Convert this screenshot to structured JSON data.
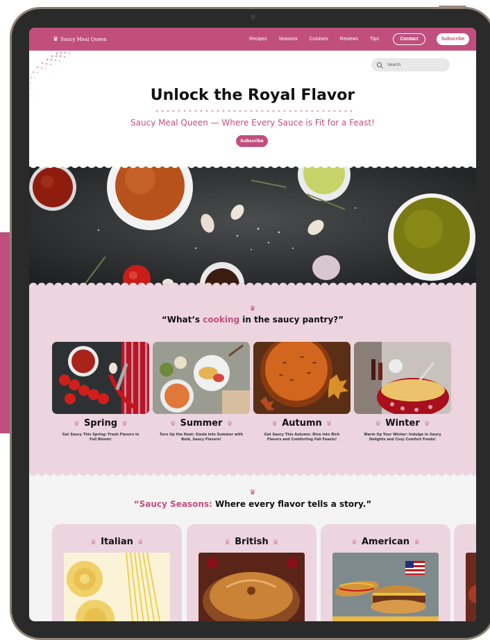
{
  "brand": {
    "name": "Saucy Meal Queen",
    "color": "#c14f7e"
  },
  "nav": {
    "links": [
      "Recipes",
      "Seasons",
      "Cuisines",
      "Reviews",
      "Tips"
    ],
    "contact_label": "Contact",
    "subscribe_label": "Subscribe"
  },
  "search": {
    "placeholder": "Search"
  },
  "hero": {
    "title": "Unlock the Royal Flavor",
    "subtitle": "Saucy Meal Queen — Where Every Sauce is Fit for a Feast!",
    "button_label": "Subscribe"
  },
  "seasons_section": {
    "title_open": "“What’s ",
    "title_accent": "cooking",
    "title_rest": " in the saucy pantry?”",
    "cards": [
      {
        "title": "Spring",
        "desc": "Get Saucy This Spring: Fresh Flavors in Full Bloom!"
      },
      {
        "title": "Summer",
        "desc": "Turn Up the Heat: Sizzle into Summer with Bold, Saucy Flavors!"
      },
      {
        "title": "Autumn",
        "desc": "Get Saucy This Autumn: Dive into Rich Flavors and Comforting Fall Feasts!"
      },
      {
        "title": "Winter",
        "desc": "Warm Up Your Winter: Indulge in Saucy Delights and Cozy Comfort Foods!"
      }
    ]
  },
  "cuisines_section": {
    "title_accent": "“Saucy Seasons:",
    "title_rest": " Where every flavor tells a story.”",
    "cards": [
      {
        "title": "Italian"
      },
      {
        "title": "British"
      },
      {
        "title": "American"
      }
    ]
  },
  "icons": [
    "crown-icon",
    "search-icon"
  ]
}
